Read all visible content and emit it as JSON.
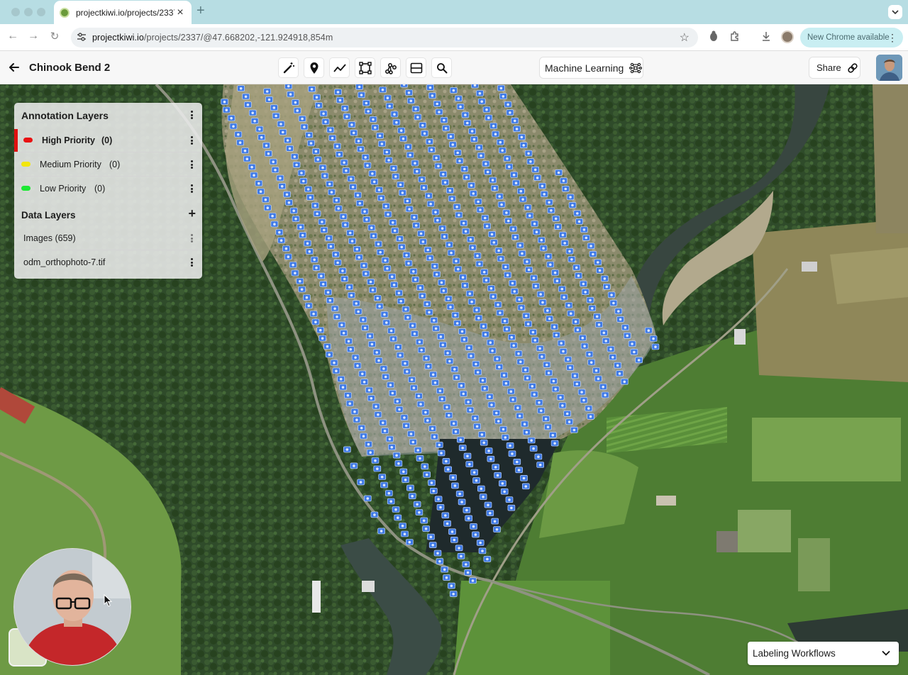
{
  "browser": {
    "tab": {
      "title": "projectkiwi.io/projects/2337"
    },
    "address_bar": {
      "url_host": "projectkiwi.io",
      "url_path": "/projects/2337/@47.668202,-121.924918,854m"
    },
    "update_pill": {
      "label": "New Chrome available"
    }
  },
  "app": {
    "project_title": "Chinook Bend 2",
    "tools": [
      {
        "icon": "magic-wand-icon"
      },
      {
        "icon": "location-pin-icon"
      },
      {
        "icon": "polyline-icon"
      },
      {
        "icon": "polygon-icon"
      },
      {
        "icon": "graph-nodes-icon"
      },
      {
        "icon": "split-view-icon"
      },
      {
        "icon": "search-icon"
      }
    ],
    "ml_button": {
      "label": "Machine Learning",
      "icon": "network-icon"
    },
    "share_button": {
      "label": "Share",
      "icon": "link-icon"
    }
  },
  "layers_panel": {
    "annotation_heading": "Annotation Layers",
    "annotation_layers": [
      {
        "name": "High Priority",
        "count": "(0)",
        "color": "#e81313",
        "selected": true
      },
      {
        "name": "Medium Priority",
        "count": "(0)",
        "color": "#f2e60c",
        "selected": false
      },
      {
        "name": "Low Priority",
        "count": "(0)",
        "color": "#1ce833",
        "selected": false
      }
    ],
    "data_heading": "Data Layers",
    "data_layers": [
      {
        "name": "Images (659)"
      },
      {
        "name": "odm_orthophoto-7.tif"
      }
    ]
  },
  "map": {
    "accent_marker_color": "#3f7ae6"
  },
  "workflows_dropdown": {
    "label": "Labeling Workflows"
  }
}
